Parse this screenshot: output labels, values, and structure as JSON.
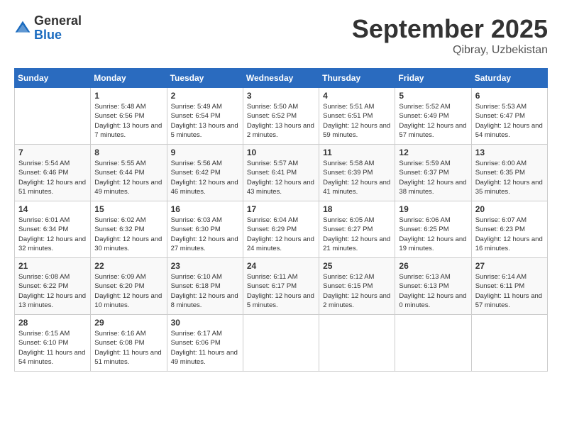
{
  "header": {
    "logo_general": "General",
    "logo_blue": "Blue",
    "month_title": "September 2025",
    "location": "Qibray, Uzbekistan"
  },
  "days_of_week": [
    "Sunday",
    "Monday",
    "Tuesday",
    "Wednesday",
    "Thursday",
    "Friday",
    "Saturday"
  ],
  "weeks": [
    [
      {
        "day": "",
        "sunrise": "",
        "sunset": "",
        "daylight": ""
      },
      {
        "day": "1",
        "sunrise": "Sunrise: 5:48 AM",
        "sunset": "Sunset: 6:56 PM",
        "daylight": "Daylight: 13 hours and 7 minutes."
      },
      {
        "day": "2",
        "sunrise": "Sunrise: 5:49 AM",
        "sunset": "Sunset: 6:54 PM",
        "daylight": "Daylight: 13 hours and 5 minutes."
      },
      {
        "day": "3",
        "sunrise": "Sunrise: 5:50 AM",
        "sunset": "Sunset: 6:52 PM",
        "daylight": "Daylight: 13 hours and 2 minutes."
      },
      {
        "day": "4",
        "sunrise": "Sunrise: 5:51 AM",
        "sunset": "Sunset: 6:51 PM",
        "daylight": "Daylight: 12 hours and 59 minutes."
      },
      {
        "day": "5",
        "sunrise": "Sunrise: 5:52 AM",
        "sunset": "Sunset: 6:49 PM",
        "daylight": "Daylight: 12 hours and 57 minutes."
      },
      {
        "day": "6",
        "sunrise": "Sunrise: 5:53 AM",
        "sunset": "Sunset: 6:47 PM",
        "daylight": "Daylight: 12 hours and 54 minutes."
      }
    ],
    [
      {
        "day": "7",
        "sunrise": "Sunrise: 5:54 AM",
        "sunset": "Sunset: 6:46 PM",
        "daylight": "Daylight: 12 hours and 51 minutes."
      },
      {
        "day": "8",
        "sunrise": "Sunrise: 5:55 AM",
        "sunset": "Sunset: 6:44 PM",
        "daylight": "Daylight: 12 hours and 49 minutes."
      },
      {
        "day": "9",
        "sunrise": "Sunrise: 5:56 AM",
        "sunset": "Sunset: 6:42 PM",
        "daylight": "Daylight: 12 hours and 46 minutes."
      },
      {
        "day": "10",
        "sunrise": "Sunrise: 5:57 AM",
        "sunset": "Sunset: 6:41 PM",
        "daylight": "Daylight: 12 hours and 43 minutes."
      },
      {
        "day": "11",
        "sunrise": "Sunrise: 5:58 AM",
        "sunset": "Sunset: 6:39 PM",
        "daylight": "Daylight: 12 hours and 41 minutes."
      },
      {
        "day": "12",
        "sunrise": "Sunrise: 5:59 AM",
        "sunset": "Sunset: 6:37 PM",
        "daylight": "Daylight: 12 hours and 38 minutes."
      },
      {
        "day": "13",
        "sunrise": "Sunrise: 6:00 AM",
        "sunset": "Sunset: 6:35 PM",
        "daylight": "Daylight: 12 hours and 35 minutes."
      }
    ],
    [
      {
        "day": "14",
        "sunrise": "Sunrise: 6:01 AM",
        "sunset": "Sunset: 6:34 PM",
        "daylight": "Daylight: 12 hours and 32 minutes."
      },
      {
        "day": "15",
        "sunrise": "Sunrise: 6:02 AM",
        "sunset": "Sunset: 6:32 PM",
        "daylight": "Daylight: 12 hours and 30 minutes."
      },
      {
        "day": "16",
        "sunrise": "Sunrise: 6:03 AM",
        "sunset": "Sunset: 6:30 PM",
        "daylight": "Daylight: 12 hours and 27 minutes."
      },
      {
        "day": "17",
        "sunrise": "Sunrise: 6:04 AM",
        "sunset": "Sunset: 6:29 PM",
        "daylight": "Daylight: 12 hours and 24 minutes."
      },
      {
        "day": "18",
        "sunrise": "Sunrise: 6:05 AM",
        "sunset": "Sunset: 6:27 PM",
        "daylight": "Daylight: 12 hours and 21 minutes."
      },
      {
        "day": "19",
        "sunrise": "Sunrise: 6:06 AM",
        "sunset": "Sunset: 6:25 PM",
        "daylight": "Daylight: 12 hours and 19 minutes."
      },
      {
        "day": "20",
        "sunrise": "Sunrise: 6:07 AM",
        "sunset": "Sunset: 6:23 PM",
        "daylight": "Daylight: 12 hours and 16 minutes."
      }
    ],
    [
      {
        "day": "21",
        "sunrise": "Sunrise: 6:08 AM",
        "sunset": "Sunset: 6:22 PM",
        "daylight": "Daylight: 12 hours and 13 minutes."
      },
      {
        "day": "22",
        "sunrise": "Sunrise: 6:09 AM",
        "sunset": "Sunset: 6:20 PM",
        "daylight": "Daylight: 12 hours and 10 minutes."
      },
      {
        "day": "23",
        "sunrise": "Sunrise: 6:10 AM",
        "sunset": "Sunset: 6:18 PM",
        "daylight": "Daylight: 12 hours and 8 minutes."
      },
      {
        "day": "24",
        "sunrise": "Sunrise: 6:11 AM",
        "sunset": "Sunset: 6:17 PM",
        "daylight": "Daylight: 12 hours and 5 minutes."
      },
      {
        "day": "25",
        "sunrise": "Sunrise: 6:12 AM",
        "sunset": "Sunset: 6:15 PM",
        "daylight": "Daylight: 12 hours and 2 minutes."
      },
      {
        "day": "26",
        "sunrise": "Sunrise: 6:13 AM",
        "sunset": "Sunset: 6:13 PM",
        "daylight": "Daylight: 12 hours and 0 minutes."
      },
      {
        "day": "27",
        "sunrise": "Sunrise: 6:14 AM",
        "sunset": "Sunset: 6:11 PM",
        "daylight": "Daylight: 11 hours and 57 minutes."
      }
    ],
    [
      {
        "day": "28",
        "sunrise": "Sunrise: 6:15 AM",
        "sunset": "Sunset: 6:10 PM",
        "daylight": "Daylight: 11 hours and 54 minutes."
      },
      {
        "day": "29",
        "sunrise": "Sunrise: 6:16 AM",
        "sunset": "Sunset: 6:08 PM",
        "daylight": "Daylight: 11 hours and 51 minutes."
      },
      {
        "day": "30",
        "sunrise": "Sunrise: 6:17 AM",
        "sunset": "Sunset: 6:06 PM",
        "daylight": "Daylight: 11 hours and 49 minutes."
      },
      {
        "day": "",
        "sunrise": "",
        "sunset": "",
        "daylight": ""
      },
      {
        "day": "",
        "sunrise": "",
        "sunset": "",
        "daylight": ""
      },
      {
        "day": "",
        "sunrise": "",
        "sunset": "",
        "daylight": ""
      },
      {
        "day": "",
        "sunrise": "",
        "sunset": "",
        "daylight": ""
      }
    ]
  ]
}
